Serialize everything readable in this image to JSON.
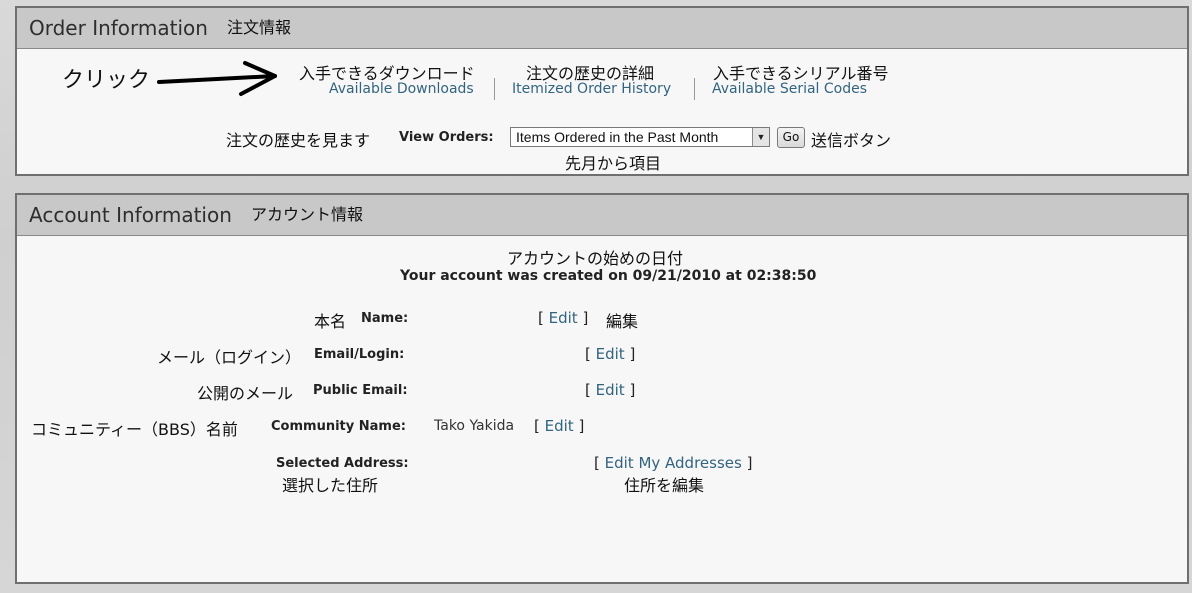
{
  "order": {
    "title": "Order Information",
    "title_jp": "注文情報",
    "click_note": "クリック",
    "links": [
      {
        "jp": "入手できるダウンロード",
        "label": "Available Downloads"
      },
      {
        "jp": "注文の歴史の詳細",
        "label": "Itemized Order History"
      },
      {
        "jp": "入手できるシリアル番号",
        "label": "Available Serial Codes"
      }
    ],
    "view_orders_jp": "注文の歴史を見ます",
    "view_orders_label": "View Orders:",
    "view_orders_value": "Items Ordered in the Past Month",
    "view_orders_value_jp": "先月から項目",
    "go_label": "Go",
    "go_jp": "送信ボタン"
  },
  "account": {
    "title": "Account Information",
    "title_jp": "アカウント情報",
    "created_jp": "アカウントの始めの日付",
    "created_text": "Your account was created on 09/21/2010 at 02:38:50",
    "edit_jp": "編集",
    "rows": [
      {
        "jp": "本名",
        "label": "Name:",
        "value": "",
        "edit": "Edit"
      },
      {
        "jp": "メール（ログイン）",
        "label": "Email/Login:",
        "value": "",
        "edit": "Edit"
      },
      {
        "jp": "公開のメール",
        "label": "Public Email:",
        "value": "",
        "edit": "Edit"
      },
      {
        "jp": "コミュニティー（BBS）名前",
        "label": "Community Name:",
        "value": "Tako Yakida",
        "edit": "Edit"
      }
    ],
    "address_label": "Selected Address:",
    "address_jp": "選択した住所",
    "address_edit": "Edit My Addresses",
    "address_edit_jp": "住所を編集"
  }
}
